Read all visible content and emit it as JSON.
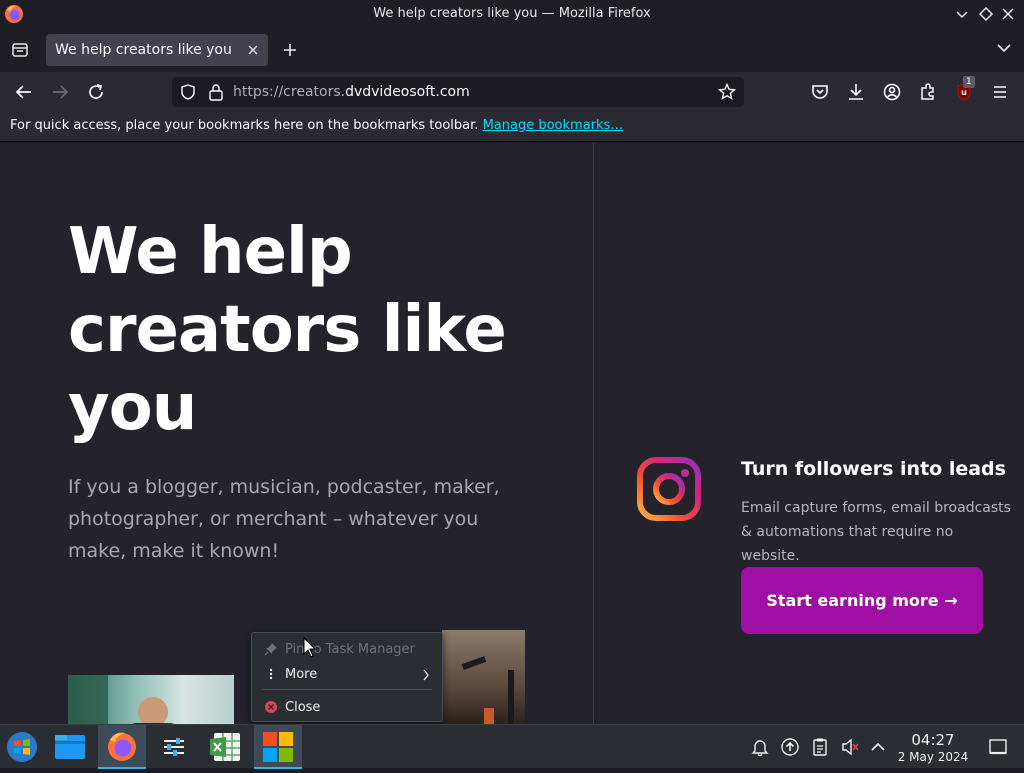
{
  "window": {
    "title": "We help creators like you — Mozilla Firefox"
  },
  "tabs": [
    {
      "label": "We help creators like you",
      "active": true
    }
  ],
  "urlbar": {
    "url_prefix": "https://creators.",
    "url_host": "dvdvideosoft.com"
  },
  "toolbar": {
    "extension_badge": "1"
  },
  "bookmarks_bar": {
    "message": "For quick access, place your bookmarks here on the bookmarks toolbar.",
    "manage_link": "Manage bookmarks…"
  },
  "page": {
    "hero_title": "We help creators like you",
    "hero_subtitle": "If you a blogger, musician, podcaster, maker, photographer, or merchant – whatever you make, make it known!",
    "feature_title": "Turn followers into leads",
    "feature_description": "Email capture forms, email broadcasts & automations that require no website.",
    "cta_label": "Start earning more →"
  },
  "context_menu": {
    "items": [
      {
        "label": "Pin to Task Manager",
        "icon": "pin-icon",
        "disabled": true
      },
      {
        "label": "More",
        "icon": "more-vertical-icon",
        "submenu": true
      },
      {
        "label": "Close",
        "icon": "close-circle-icon"
      }
    ]
  },
  "taskbar": {
    "apps": [
      "start-menu-icon",
      "file-manager-icon",
      "firefox-icon",
      "settings-icon",
      "spreadsheet-icon",
      "app-grid-icon"
    ],
    "clock_time": "04:27",
    "clock_date": "2 May 2024"
  },
  "colors": {
    "accent_cta": "#a00fa3",
    "link": "#00ddff",
    "page_bg": "#24232b"
  }
}
